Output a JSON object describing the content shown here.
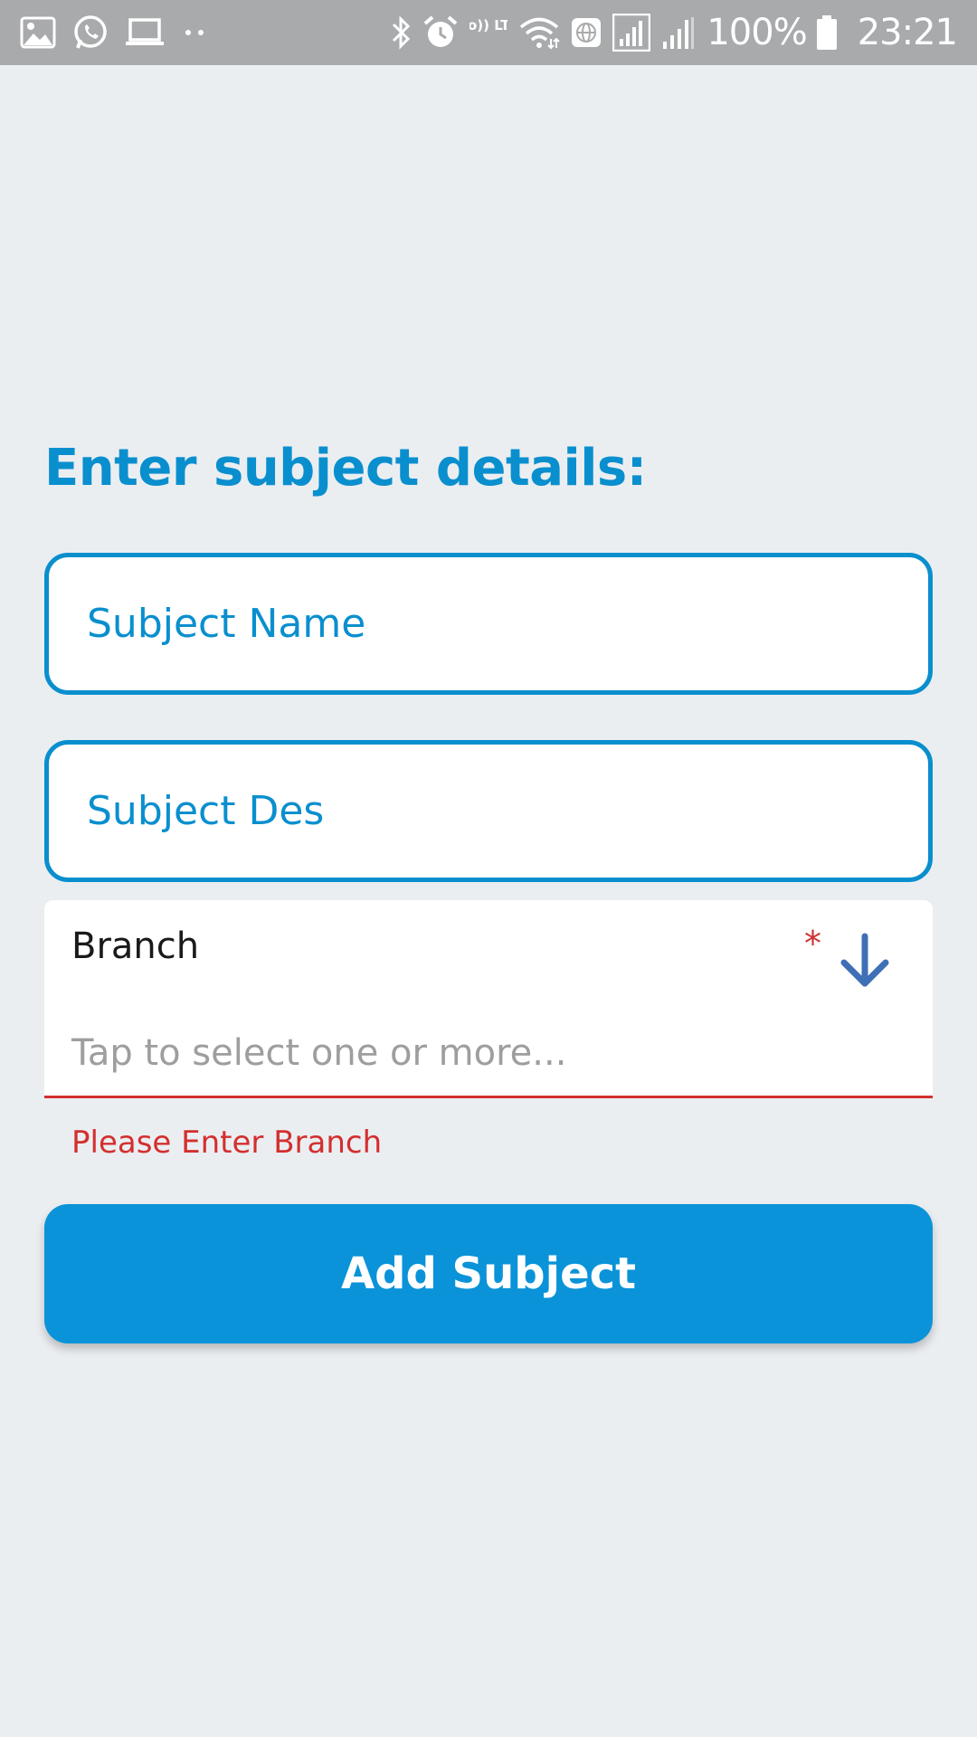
{
  "status_bar": {
    "left_icons": [
      "image-icon",
      "whatsapp-icon",
      "laptop-icon",
      "more-dots-icon"
    ],
    "right_icons": [
      "bluetooth-icon",
      "alarm-icon",
      "volte-icon",
      "wifi-icon",
      "globe-icon",
      "signal-1-icon",
      "signal-2-icon",
      "battery-icon"
    ],
    "volte_text": "Vo)) LTE",
    "battery_percent": "100%",
    "time": "23:21"
  },
  "form": {
    "title": "Enter subject details:",
    "subject_name_placeholder": "Subject Name",
    "subject_desc_placeholder": "Subject Des",
    "branch": {
      "label": "Branch",
      "required_marker": "*",
      "placeholder": "Tap to select one or more...",
      "error": "Please Enter Branch",
      "arrow_icon": "arrow-down-icon"
    },
    "submit_label": "Add Subject"
  },
  "colors": {
    "accent": "#0a8fce",
    "button": "#0a93d8",
    "error": "#d32f2f",
    "background": "#ebeef1",
    "status_bar": "#a9aaac"
  }
}
